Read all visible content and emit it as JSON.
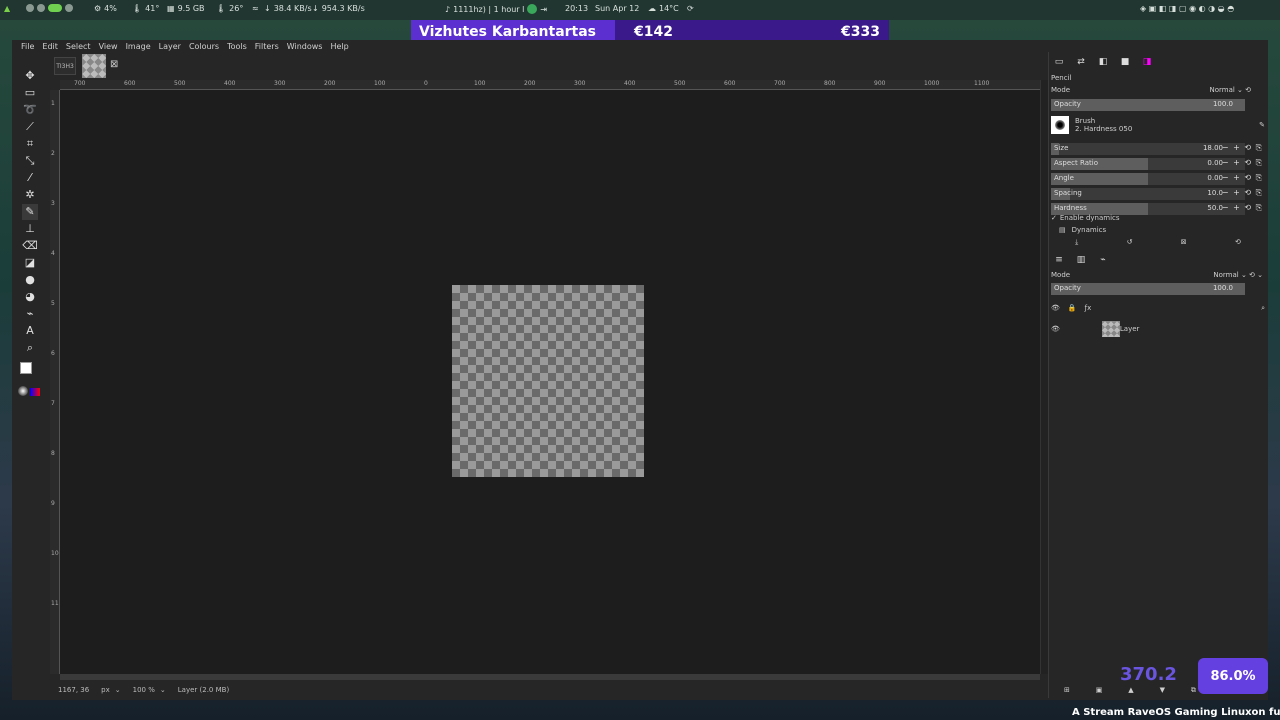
{
  "sysbar": {
    "cpu": "4%",
    "cpu_temp": "41°",
    "mem": "9.5 GB",
    "gpu_temp": "26°",
    "net_down": "38.4 KB/s",
    "net_up": "954.3 KB/s",
    "media": "1111hz) | 1 hour l",
    "time": "20:13",
    "date": "Sun Apr 12",
    "weather": "14°C"
  },
  "banner": {
    "name": "Vizhutes Karbantartas",
    "price1": "€142",
    "price2": "€333"
  },
  "menu": [
    "File",
    "Edit",
    "Select",
    "View",
    "Image",
    "Layer",
    "Colours",
    "Tools",
    "Filters",
    "Windows",
    "Help"
  ],
  "image_tab": {
    "label": "TI3H3"
  },
  "ruler": {
    "h_ticks": [
      "700",
      "600",
      "500",
      "400",
      "300",
      "200",
      "100",
      "0",
      "100",
      "200",
      "300",
      "400",
      "500",
      "600",
      "700",
      "800",
      "900",
      "1000",
      "1100"
    ],
    "v_ticks": [
      "1",
      "2",
      "3",
      "4",
      "5",
      "6",
      "7",
      "8",
      "9",
      "10",
      "11"
    ]
  },
  "status": {
    "coords": "1167, 36",
    "unit": "px",
    "zoom": "100 %",
    "layer_info": "Layer (2.0 MB)"
  },
  "tool_options": {
    "title": "Pencil",
    "mode_label": "Mode",
    "mode_value": "Normal",
    "opacity_label": "Opacity",
    "opacity_value": "100.0",
    "brush_label": "Brush",
    "brush_name": "2. Hardness 050",
    "sliders": [
      {
        "label": "Size",
        "value": "18.00",
        "fill": 0.04
      },
      {
        "label": "Aspect Ratio",
        "value": "0.00",
        "fill": 0.5
      },
      {
        "label": "Angle",
        "value": "0.00",
        "fill": 0.5
      },
      {
        "label": "Spacing",
        "value": "10.0",
        "fill": 0.1
      },
      {
        "label": "Hardness",
        "value": "50.0",
        "fill": 0.5
      }
    ],
    "dynamics_toggle": "Enable dynamics",
    "dynamics_label": "Dynamics"
  },
  "layers": {
    "mode_label": "Mode",
    "mode_value": "Normal",
    "opacity_label": "Opacity",
    "opacity_value": "100.0",
    "items": [
      {
        "name": "Layer"
      }
    ]
  },
  "osd": {
    "fps": "370.2",
    "percent": "86.0%",
    "ticker": "A Stream RaveOS Gaming Linuxon fut"
  }
}
